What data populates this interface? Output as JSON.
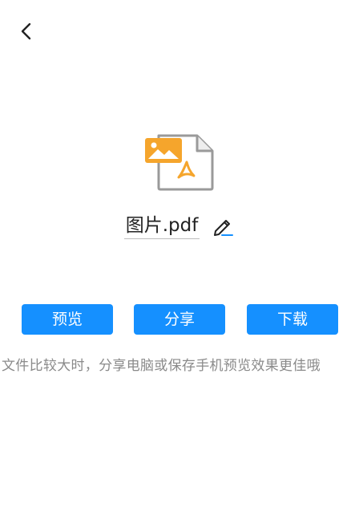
{
  "header": {
    "back_icon": "chevron-left-icon"
  },
  "file": {
    "icon": "image-pdf-file-icon",
    "name": "图片.pdf",
    "edit_icon": "pencil-icon"
  },
  "actions": {
    "preview_label": "预览",
    "share_label": "分享",
    "download_label": "下载"
  },
  "hint": {
    "text": "文件比较大时，分享电脑或保存手机预览效果更佳哦"
  },
  "colors": {
    "primary": "#1590ff",
    "icon_orange": "#f5a52c",
    "icon_gray": "#9a9a9a",
    "hint_text": "#8a8a8a"
  }
}
